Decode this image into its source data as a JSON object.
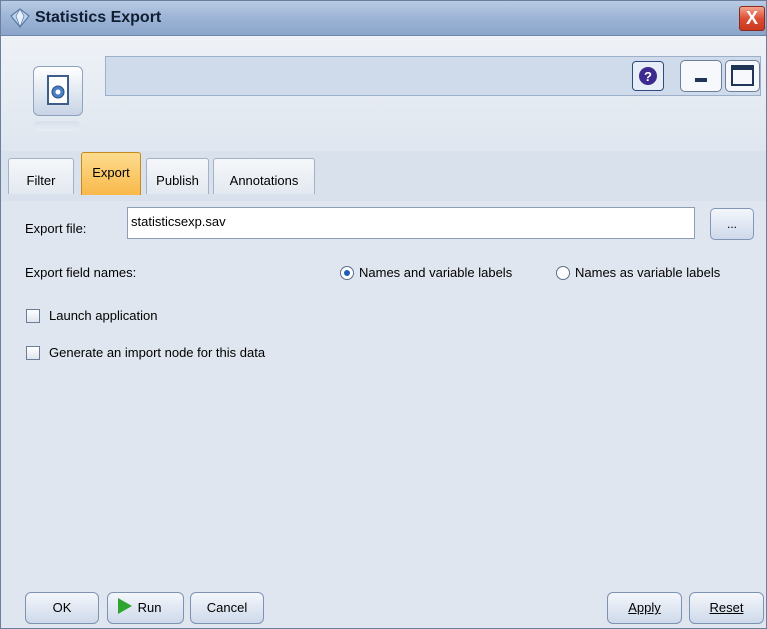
{
  "window": {
    "title": "Statistics Export",
    "close_label": "X"
  },
  "tabs": [
    {
      "label": "Filter"
    },
    {
      "label": "Export"
    },
    {
      "label": "Publish"
    },
    {
      "label": "Annotations"
    }
  ],
  "active_tab": "Export",
  "export": {
    "file_label": "Export file:",
    "file_value": "statisticsexp.sav",
    "browse_label": "...",
    "field_names_label": "Export field names:",
    "radio_names_and_labels": "Names and variable labels",
    "radio_names_as_labels": "Names as variable labels",
    "radio_selected": "Names and variable labels",
    "launch_label": "Launch application",
    "launch_checked": false,
    "generate_label": "Generate an import node for this data",
    "generate_checked": false
  },
  "buttons": {
    "ok": "OK",
    "run": "Run",
    "cancel": "Cancel",
    "apply": "Apply",
    "reset": "Reset"
  },
  "colors": {
    "active_tab": "#f9b94b",
    "run_arrow": "#2fa52f",
    "close": "#dc4f35"
  }
}
